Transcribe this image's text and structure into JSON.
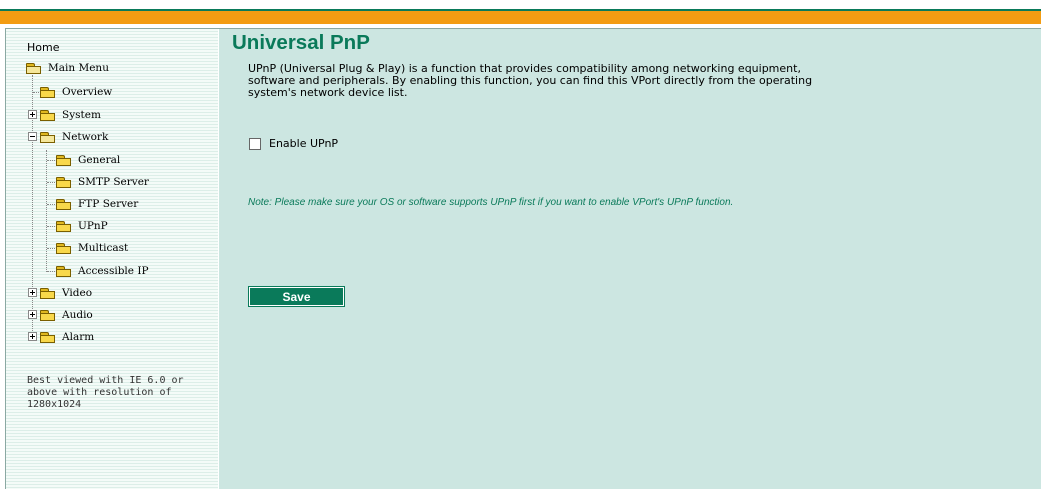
{
  "sidebar": {
    "home": "Home",
    "items": [
      {
        "label": "Main Menu",
        "icon": "folder-open-icon"
      },
      {
        "label": "Overview",
        "icon": "folder-icon"
      },
      {
        "label": "System",
        "icon": "folder-icon",
        "expander": "plus"
      },
      {
        "label": "Network",
        "icon": "folder-open-icon",
        "expander": "minus"
      },
      {
        "label": "General",
        "icon": "folder-icon"
      },
      {
        "label": "SMTP Server",
        "icon": "folder-icon"
      },
      {
        "label": "FTP Server",
        "icon": "folder-icon"
      },
      {
        "label": "UPnP",
        "icon": "folder-icon"
      },
      {
        "label": "Multicast",
        "icon": "folder-icon"
      },
      {
        "label": "Accessible IP",
        "icon": "folder-icon"
      },
      {
        "label": "Video",
        "icon": "folder-icon",
        "expander": "plus"
      },
      {
        "label": "Audio",
        "icon": "folder-icon",
        "expander": "plus"
      },
      {
        "label": "Alarm",
        "icon": "folder-icon",
        "expander": "plus"
      }
    ],
    "note": "Best viewed with IE 6.0 or above with resolution of 1280x1024"
  },
  "main": {
    "title": "Universal PnP",
    "description": "UPnP (Universal Plug & Play) is a function that provides compatibility among networking equipment, software and peripherals. By enabling this function, you can find this VPort directly from the operating system's network device list.",
    "enable_upnp_label": "Enable UPnP",
    "enable_upnp_checked": false,
    "note": "Note: Please make sure your OS or software supports UPnP first if you want to enable VPort's UPnP function.",
    "save_label": "Save"
  },
  "colors": {
    "accent_green": "#0a7a5a",
    "banner_orange": "#f39c12",
    "main_background": "#cce6e1"
  }
}
